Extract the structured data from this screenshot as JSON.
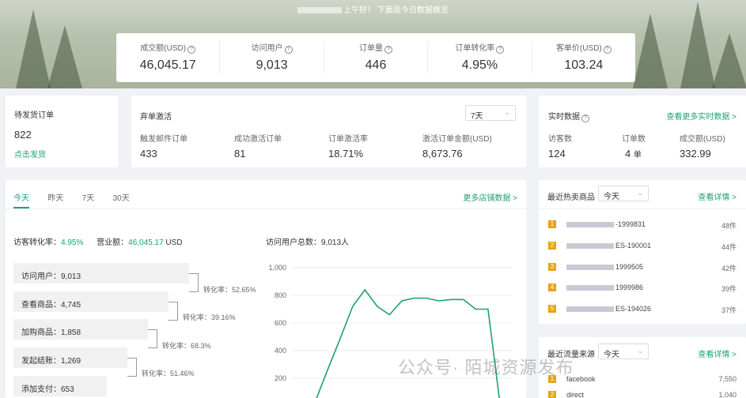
{
  "header": {
    "greeting": "上午好！ 下面是今日数据概览"
  },
  "kpis": [
    {
      "label": "成交额(USD)",
      "value": "46,045.17"
    },
    {
      "label": "访问用户",
      "value": "9,013"
    },
    {
      "label": "订单量",
      "value": "446"
    },
    {
      "label": "订单转化率",
      "value": "4.95%"
    },
    {
      "label": "客单价(USD)",
      "value": "103.24"
    }
  ],
  "pending": {
    "title": "待发货订单",
    "count": "822",
    "action": "点击发货"
  },
  "abandon": {
    "title": "弃单激活",
    "period": "7天",
    "items": [
      {
        "label": "触发邮件订单",
        "value": "433"
      },
      {
        "label": "成功激活订单",
        "value": "81"
      },
      {
        "label": "订单激活率",
        "value": "18.71%"
      },
      {
        "label": "激活订单金额(USD)",
        "value": "8,673.76"
      }
    ]
  },
  "realtime": {
    "title": "实时数据",
    "link": "查看更多实时数据 >",
    "items": [
      {
        "label": "访客数",
        "value": "124",
        "unit": ""
      },
      {
        "label": "订单数",
        "value": "4",
        "unit": "单"
      },
      {
        "label": "成交额(USD)",
        "value": "332.99",
        "unit": ""
      }
    ]
  },
  "store": {
    "tabs": [
      "今天",
      "昨天",
      "7天",
      "30天"
    ],
    "more_link": "更多店铺数据 >",
    "visitor_conv_label": "访客转化率：",
    "visitor_conv_value": "4.95%",
    "revenue_label": "营业额：",
    "revenue_value": "46,045.17",
    "revenue_unit": "USD",
    "total_label": "访问用户总数：9,013人",
    "funnel": [
      {
        "label": "访问用户：9,013",
        "conv": "转化率：52.65%"
      },
      {
        "label": "查看商品：4,745",
        "conv": "转化率：39.16%"
      },
      {
        "label": "加购商品：1,858",
        "conv": "转化率：68.3%"
      },
      {
        "label": "发起结账：1,269",
        "conv": "转化率：51.46%"
      },
      {
        "label": "添加支付：653",
        "conv": ""
      }
    ]
  },
  "chart_data": {
    "type": "line",
    "title": "",
    "xlabel": "",
    "ylabel": "",
    "ylim": [
      0,
      1000
    ],
    "yticks": [
      "1,000",
      "800",
      "600",
      "400",
      "200"
    ],
    "x": [
      0,
      1,
      2,
      3,
      4,
      5,
      6,
      7,
      8,
      9,
      10,
      11,
      12,
      13,
      14,
      15,
      16,
      17,
      18
    ],
    "values": [
      40,
      0,
      40,
      270,
      490,
      720,
      840,
      720,
      660,
      760,
      780,
      780,
      760,
      770,
      770,
      700,
      700,
      0,
      0
    ],
    "color": "#1aa179"
  },
  "hot": {
    "title": "最近热卖商品",
    "period": "今天",
    "link": "查看详情 >",
    "items": [
      {
        "rank": "1",
        "name": "-1999831",
        "count": "48件"
      },
      {
        "rank": "2",
        "name": "ES-190001",
        "count": "44件"
      },
      {
        "rank": "3",
        "name": "1999505",
        "count": "42件"
      },
      {
        "rank": "4",
        "name": "1999986",
        "count": "39件"
      },
      {
        "rank": "5",
        "name": "ES-194026",
        "count": "37件"
      }
    ]
  },
  "traffic": {
    "title": "最近流量来源",
    "period": "今天",
    "link": "查看详情 >",
    "items": [
      {
        "rank": "1",
        "name": "facebook",
        "count": "7,550"
      },
      {
        "rank": "2",
        "name": "direct",
        "count": "1,040"
      }
    ]
  },
  "watermark": "公众号· 陌城资源发布"
}
